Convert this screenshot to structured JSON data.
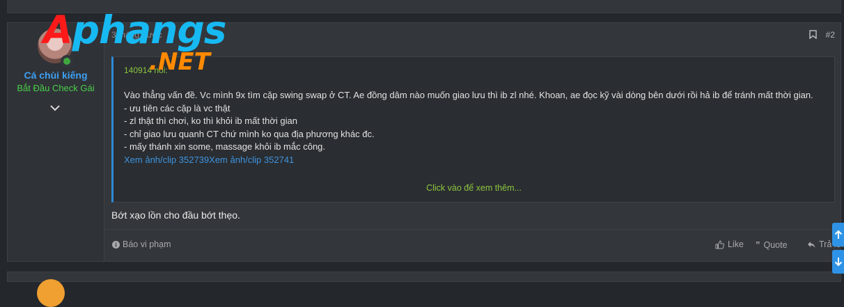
{
  "post": {
    "user": {
      "name": "Cá chùi kiếng",
      "title": "Bắt Đầu Check Gái"
    },
    "date": "3 tháng trước",
    "post_number": "#2",
    "quote": {
      "author": "140914 nói:",
      "lines": [
        "Vào thẳng vấn đề. Vc mình 9x tìm cặp swing swap ở CT. Ae đồng dâm nào muốn giao lưu thì ib zl nhé. Khoan, ae đọc kỹ vài dòng bên dưới rồi hả ib để tránh mất thời gian.",
        "- ưu tiên các cặp là vc thật",
        "- zl thật thì chơi, ko thì khỏi ib mất thời gian",
        "- chỉ giao lưu quanh CT chứ mình ko qua địa phương khác đc.",
        "- mấy thánh xin some, massage khỏi ib mắc công."
      ],
      "links": "Xem ảnh/clip 352739Xem ảnh/clip 352741",
      "expand_label": "Click vào để xem thêm..."
    },
    "reply_text": "Bớt xạo lồn cho đầu bớt thẹo.",
    "actions": {
      "report": "Báo vi phạm",
      "like": "Like",
      "quote": "Quote",
      "reply": "Trả lời"
    }
  },
  "logo": {
    "part1_red": "A",
    "part1_blue": "phangs",
    "part2": ".NET"
  },
  "icons": [
    "bookmark-icon",
    "chevron-down-icon",
    "info-icon",
    "thumbs-up-icon",
    "quote-icon",
    "reply-icon",
    "arrow-up-icon",
    "arrow-down-icon"
  ],
  "colors": {
    "accent": "#2e93e6",
    "username": "#3ea0f3",
    "usertitle": "#4ad04a",
    "quote_author": "#8cc63f",
    "background": "#24272b",
    "panel": "#33363b"
  }
}
